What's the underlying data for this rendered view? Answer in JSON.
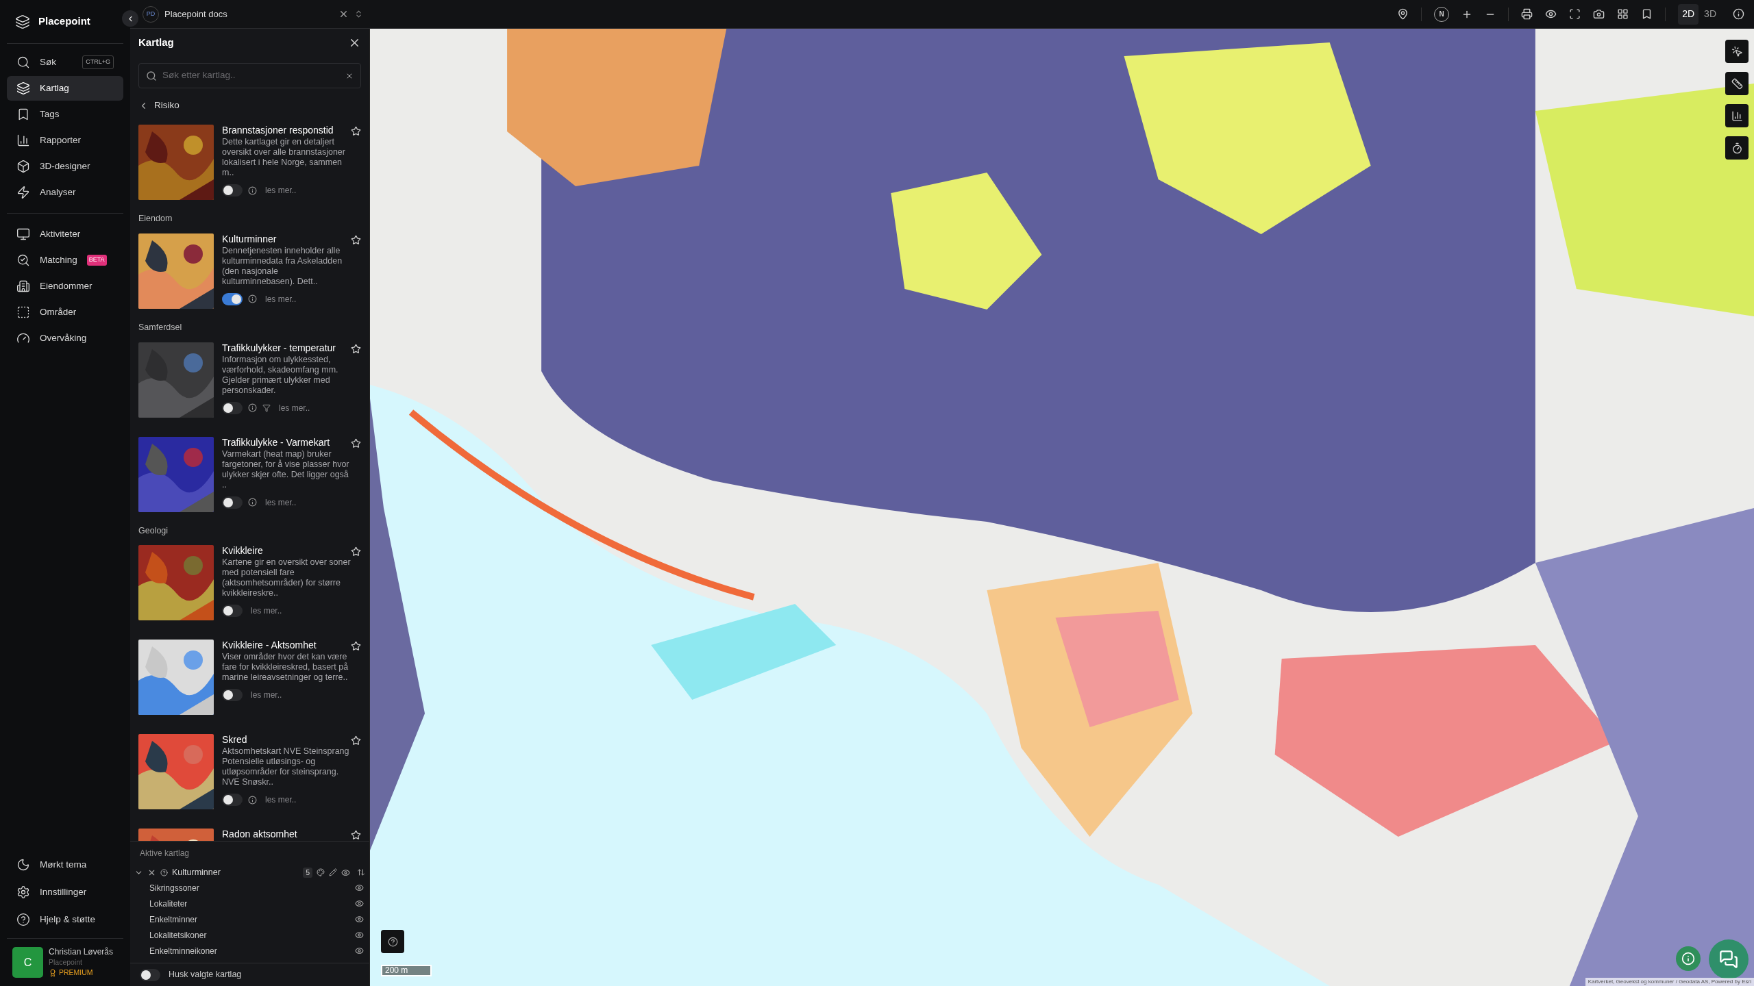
{
  "nav": {
    "brand": "Placepoint",
    "items": [
      {
        "kind": "search",
        "label": "Søk",
        "shortcut": "CTRL+G",
        "selected": false
      },
      {
        "kind": "layers",
        "label": "Kartlag",
        "selected": true
      },
      {
        "kind": "tags",
        "label": "Tags",
        "selected": false
      },
      {
        "kind": "reports",
        "label": "Rapporter",
        "selected": false
      },
      {
        "kind": "cube",
        "label": "3D-designer",
        "selected": false
      },
      {
        "kind": "bolt",
        "label": "Analyser",
        "selected": false
      },
      {
        "kind": "divider"
      },
      {
        "kind": "activity",
        "label": "Aktiviteter",
        "selected": false
      },
      {
        "kind": "matching",
        "label": "Matching",
        "badge": "BETA",
        "selected": false
      },
      {
        "kind": "building",
        "label": "Eiendommer",
        "selected": false
      },
      {
        "kind": "area",
        "label": "Områder",
        "selected": false
      },
      {
        "kind": "gauge",
        "label": "Overvåking",
        "selected": false
      }
    ],
    "bottom_items": [
      {
        "kind": "moon",
        "label": "Mørkt tema"
      },
      {
        "kind": "settings",
        "label": "Innstillinger"
      },
      {
        "kind": "help",
        "label": "Hjelp & støtte"
      }
    ],
    "user": {
      "initial": "C",
      "name": "Christian Løverås",
      "org": "Placepoint",
      "plan": "PREMIUM"
    }
  },
  "tab": {
    "initials": "PD",
    "title": "Placepoint docs"
  },
  "toolbar": {
    "compass": "N",
    "view_modes": [
      {
        "label": "2D",
        "selected": true
      },
      {
        "label": "3D",
        "selected": false
      }
    ]
  },
  "panel": {
    "title": "Kartlag",
    "search": {
      "placeholder": "Søk etter kartlag.."
    },
    "back": "Risiko",
    "sections": [
      {
        "layers": [
          {
            "title": "Brannstasjoner responstid",
            "description": "Dette kartlaget gir en detaljert oversikt over alle brannstasjoner lokalisert i hele Norge, sammen m..",
            "on": false,
            "info": true,
            "filter": false,
            "more": "les mer.."
          }
        ]
      },
      {
        "heading": "Eiendom",
        "layers": [
          {
            "title": "Kulturminner",
            "description": "Dennetjenesten inneholder alle kulturminnedata fra Askeladden (den nasjonale kulturminnebasen). Dett..",
            "on": true,
            "info": true,
            "filter": false,
            "more": "les mer.."
          }
        ]
      },
      {
        "heading": "Samferdsel",
        "layers": [
          {
            "title": "Trafikkulykker - temperatur",
            "description": "Informasjon om ulykkessted, værforhold, skadeomfang mm. Gjelder primært ulykker med personskader.",
            "on": false,
            "info": true,
            "filter": true,
            "more": "les mer.."
          },
          {
            "title": "Trafikkulykke - Varmekart",
            "description": "Varmekart (heat map) bruker fargetoner, for å vise plasser hvor ulykker skjer ofte. Det ligger også ..",
            "on": false,
            "info": true,
            "filter": false,
            "more": "les mer.."
          }
        ]
      },
      {
        "heading": "Geologi",
        "layers": [
          {
            "title": "Kvikkleire",
            "description": "Kartene gir en oversikt over soner med potensiell fare (aktsomhetsområder) for større kvikkleireskre..",
            "on": false,
            "info": false,
            "filter": false,
            "more": "les mer.."
          },
          {
            "title": "Kvikkleire - Aktsomhet",
            "description": "Viser områder hvor det kan være fare for kvikkleireskred, basert på marine leireavsetninger og terre..",
            "on": false,
            "info": false,
            "filter": false,
            "more": "les mer.."
          },
          {
            "title": "Skred",
            "description": "Aktsomhetskart NVE Steinsprang Potensielle utløsings- og utløpsområder for steinsprang. NVE Snøskr..",
            "on": false,
            "info": true,
            "filter": false,
            "more": "les mer.."
          },
          {
            "title": "Radon aktsomhet"
          }
        ]
      }
    ],
    "active": {
      "title": "Aktive kartlag",
      "groups": [
        {
          "name": "Kulturminner",
          "count": "5",
          "expanded": true,
          "children": [
            {
              "name": "Sikringssoner"
            },
            {
              "name": "Lokaliteter"
            },
            {
              "name": "Enkeltminner"
            },
            {
              "name": "Lokalitetsikoner"
            },
            {
              "name": "Enkeltminneikoner"
            }
          ]
        }
      ]
    },
    "remember": {
      "label": "Husk valgte kartlag",
      "on": false
    }
  },
  "map": {
    "scale": "200 m",
    "attribution": "Kartverket, Geovekst og kommuner / Geodata AS, Powered by Esri"
  }
}
